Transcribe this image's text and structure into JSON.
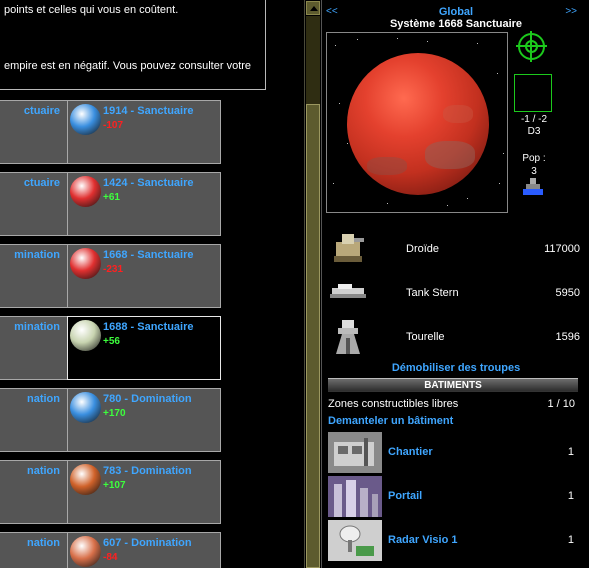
{
  "notice": {
    "line1": "points et celles qui vous en coûtent.",
    "line2": "empire est en négatif. Vous pouvez consulter votre"
  },
  "left_cards": [
    {
      "label": "ctuaire"
    },
    {
      "label": "ctuaire"
    },
    {
      "label": "mination"
    },
    {
      "label": "mination"
    },
    {
      "label": "nation"
    },
    {
      "label": "nation"
    },
    {
      "label": "nation"
    }
  ],
  "planets": [
    {
      "name": "1914 - Sanctuaire",
      "value": "-107",
      "color": "#3a8fe0",
      "state": "neg"
    },
    {
      "name": "1424 - Sanctuaire",
      "value": "+61",
      "color": "#e03030",
      "state": "pos"
    },
    {
      "name": "1668 - Sanctuaire",
      "value": "-231",
      "color": "#e03030",
      "state": "neg"
    },
    {
      "name": "1688 - Sanctuaire",
      "value": "+56",
      "color": "#c8d4b0",
      "state": "pos",
      "selected": true
    },
    {
      "name": "780 - Domination",
      "value": "+170",
      "color": "#3a8fe0",
      "state": "pos"
    },
    {
      "name": "783 - Domination",
      "value": "+107",
      "color": "#d0622a",
      "state": "pos"
    },
    {
      "name": "607 - Domination",
      "value": "-84",
      "color": "#d8704a",
      "state": "neg"
    }
  ],
  "right": {
    "nav_prev": "<<",
    "nav_next": ">>",
    "global": "Global",
    "system": "Système 1668 Sanctuaire",
    "coords": "-1 / -2",
    "sector": "D3",
    "pop_label": "Pop :",
    "pop_value": "3",
    "units": [
      {
        "name": "Droïde",
        "qty": "117000",
        "icon": "droid-icon"
      },
      {
        "name": "Tank Stern",
        "qty": "5950",
        "icon": "tank-icon"
      },
      {
        "name": "Tourelle",
        "qty": "1596",
        "icon": "turret-icon"
      }
    ],
    "demob": "Démobiliser des troupes",
    "batiments": "BATIMENTS",
    "zones_label": "Zones constructibles libres",
    "zones_value": "1 / 10",
    "demanteler": "Demanteler un bâtiment",
    "buildings": [
      {
        "name": "Chantier",
        "qty": "1",
        "icon": "shipyard-icon"
      },
      {
        "name": "Portail",
        "qty": "1",
        "icon": "portal-icon"
      },
      {
        "name": "Radar Visio 1",
        "qty": "1",
        "icon": "radar-icon"
      }
    ]
  },
  "colors": {
    "accent": "#3fa6ff",
    "positive": "#3dff3d",
    "negative": "#ff2020",
    "card_bg": "#555555"
  }
}
